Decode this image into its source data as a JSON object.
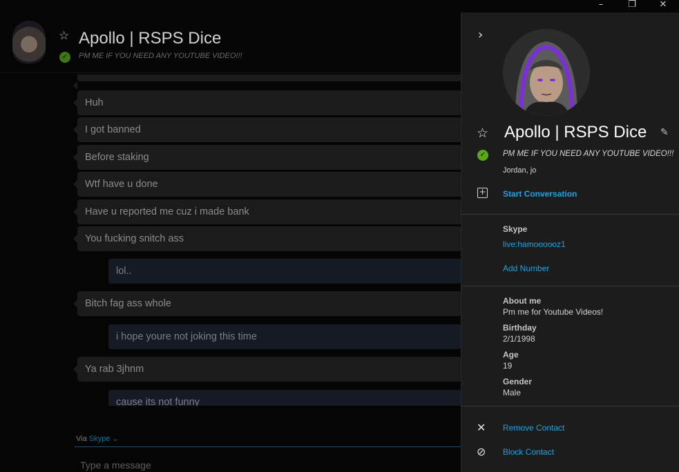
{
  "window": {
    "minimize_glyph": "–",
    "maximize_glyph": "❐",
    "close_glyph": "✕"
  },
  "chat": {
    "contact_name": "Apollo | RSPS Dice",
    "mood": "PM ME IF YOU NEED ANY YOUTUBE VIDEO!!!",
    "messages": [
      {
        "dir": "in",
        "text": "Huh"
      },
      {
        "dir": "in",
        "text": "I got banned"
      },
      {
        "dir": "in",
        "text": "Before staking"
      },
      {
        "dir": "in",
        "text": "Wtf have u done"
      },
      {
        "dir": "in",
        "text": "Have u reported me cuz i made bank"
      },
      {
        "dir": "in",
        "text": "You fucking snitch ass"
      },
      {
        "dir": "out",
        "text": "lol.."
      },
      {
        "dir": "in",
        "text": "Bitch fag ass whole"
      },
      {
        "dir": "out",
        "text": "i hope youre not joking this time"
      },
      {
        "dir": "in",
        "text": "Ya rab 3jhnm"
      },
      {
        "dir": "out",
        "text": "cause its not funny"
      }
    ],
    "via_label": "Via",
    "via_service": "Skype",
    "compose_placeholder": "Type a message"
  },
  "profile": {
    "name": "Apollo | RSPS Dice",
    "mood": "PM ME IF YOU NEED ANY YOUTUBE VIDEO!!!",
    "location": "Jordan, jo",
    "start_conversation": "Start Conversation",
    "skype_label": "Skype",
    "skype_id": "live:hamoooooz1",
    "add_number": "Add Number",
    "about_label": "About me",
    "about_value": "Pm me for Youtube Videos!",
    "birthday_label": "Birthday",
    "birthday_value": "2/1/1998",
    "age_label": "Age",
    "age_value": "19",
    "gender_label": "Gender",
    "gender_value": "Male",
    "remove_contact": "Remove Contact",
    "block_contact": "Block Contact"
  },
  "icons": {
    "star": "star-icon",
    "check": "check-circle-icon",
    "edit": "pencil-icon",
    "collapse": "chevron-right-icon",
    "add_conversation": "plus-box-icon",
    "remove": "close-icon",
    "block": "block-icon"
  },
  "colors": {
    "accent": "#19a3e3",
    "online": "#5aa51a",
    "panel_bg": "#1c1c1c"
  }
}
